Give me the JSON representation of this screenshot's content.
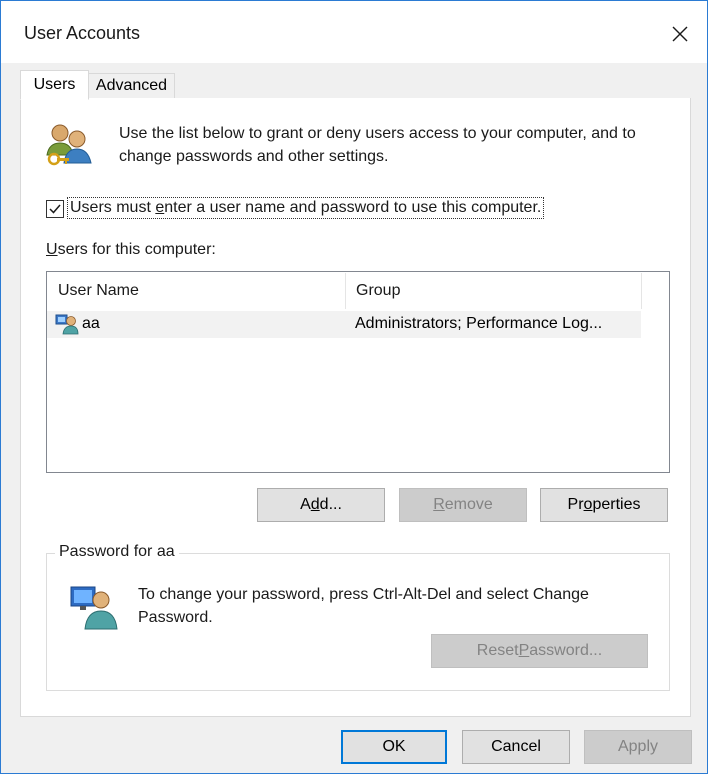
{
  "window": {
    "title": "User Accounts",
    "close_label": "✕"
  },
  "tabs": [
    {
      "label": "Users",
      "active": true
    },
    {
      "label": "Advanced",
      "active": false
    }
  ],
  "intro_text": "Use the list below to grant or deny users access to your computer, and to change passwords and other settings.",
  "require_login": {
    "checked": true,
    "label_pre": "Users must ",
    "label_key": "e",
    "label_post": "nter a user name and password to use this computer."
  },
  "users_label": {
    "key": "U",
    "rest": "sers for this computer:"
  },
  "users_table": {
    "columns": [
      "User Name",
      "Group"
    ],
    "rows": [
      {
        "name": "aa",
        "group": "Administrators; Performance Log..."
      }
    ]
  },
  "user_buttons": {
    "add": {
      "pre": "A",
      "key": "d",
      "post": "d..."
    },
    "remove": {
      "pre": "",
      "key": "R",
      "post": "emove"
    },
    "properties": {
      "pre": "Pr",
      "key": "o",
      "post": "perties"
    }
  },
  "password_group": {
    "title": "Password for aa",
    "text": "To change your password, press Ctrl-Alt-Del and select Change Password.",
    "reset_pre": "Reset ",
    "reset_key": "P",
    "reset_post": "assword..."
  },
  "dialog_buttons": {
    "ok": "OK",
    "cancel": "Cancel",
    "apply": "Apply"
  },
  "colors": {
    "accent": "#0078d7",
    "window_border": "#2b7bd3",
    "disabled_text": "#838383"
  }
}
